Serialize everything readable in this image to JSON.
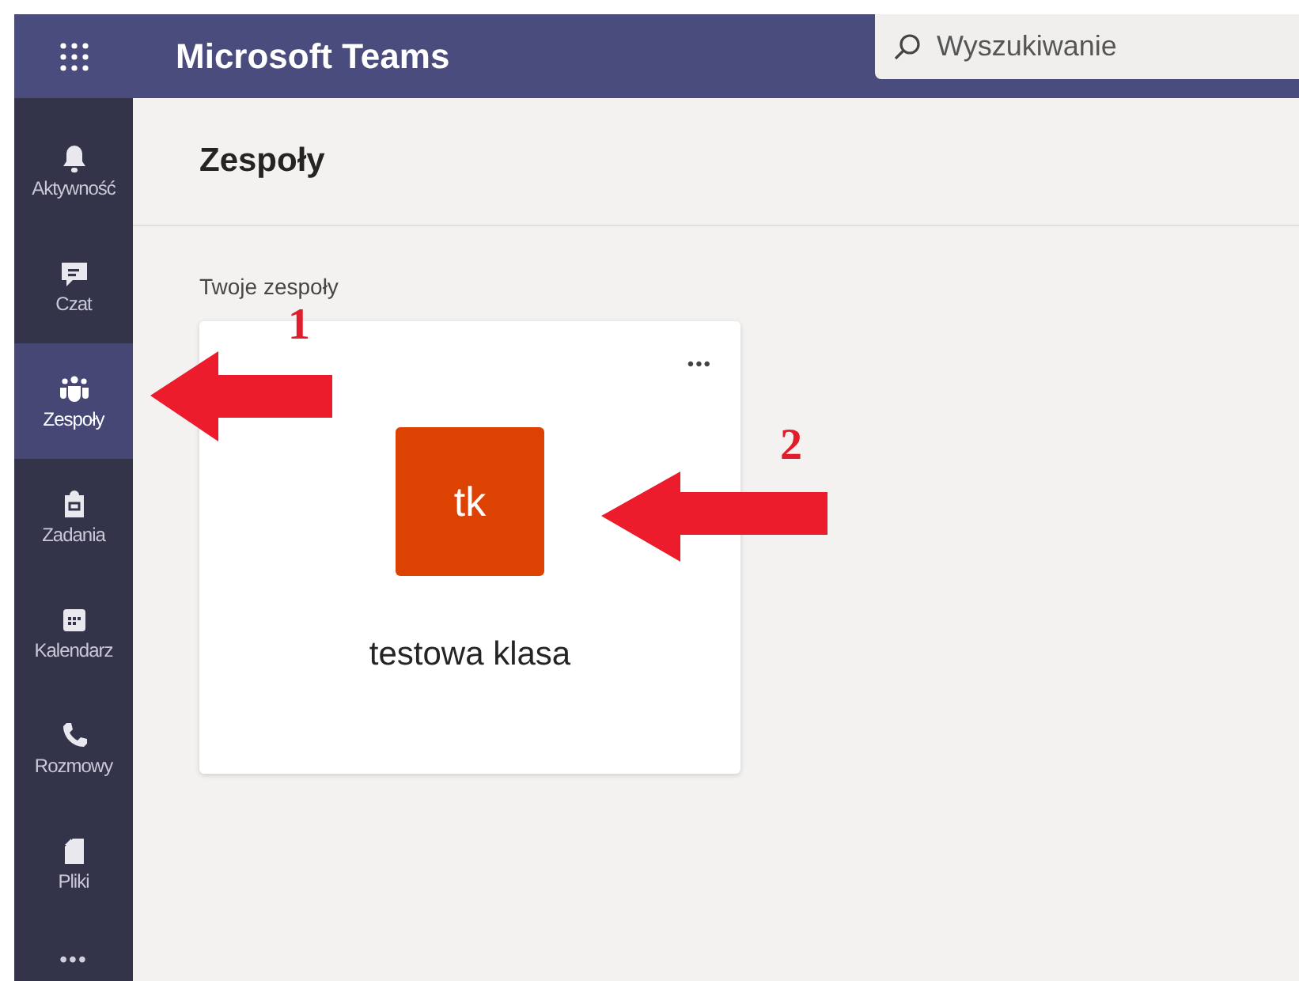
{
  "app_bar": {
    "title": "Microsoft Teams",
    "search": {
      "placeholder": "Wyszukiwanie"
    }
  },
  "sidebar": {
    "items": [
      {
        "label": "Aktywność",
        "kind": "bell",
        "selected": false
      },
      {
        "label": "Czat",
        "kind": "chat",
        "selected": false
      },
      {
        "label": "Zespoły",
        "kind": "teams",
        "selected": true
      },
      {
        "label": "Zadania",
        "kind": "bag",
        "selected": false
      },
      {
        "label": "Kalendarz",
        "kind": "calendar",
        "selected": false
      },
      {
        "label": "Rozmowy",
        "kind": "phone",
        "selected": false
      },
      {
        "label": "Pliki",
        "kind": "file",
        "selected": false
      }
    ],
    "more": "•••"
  },
  "page": {
    "title": "Zespoły",
    "section": "Twoje zespoły",
    "teams": [
      {
        "initials": "tk",
        "name": "testowa klasa",
        "color": "#dc4303",
        "more": "•••"
      }
    ]
  },
  "annotations": [
    {
      "number": "1"
    },
    {
      "number": "2"
    }
  ]
}
